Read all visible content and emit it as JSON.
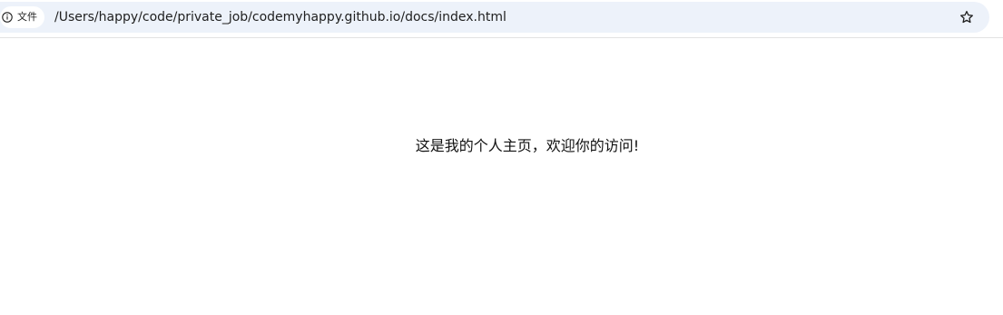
{
  "address_bar": {
    "site_info_icon": "info-circle-icon",
    "site_chip_label": "文件",
    "url": "/Users/happy/code/private_job/codemyhappy.github.io/docs/index.html",
    "bookmark_icon": "star-outline-icon"
  },
  "page": {
    "welcome_text": "这是我的个人主页，欢迎你的访问!"
  },
  "colors": {
    "omnibox_bg": "#edf2fa",
    "chip_bg": "#ffffff",
    "text": "#1f1f1f",
    "divider": "#e3e3e3"
  }
}
